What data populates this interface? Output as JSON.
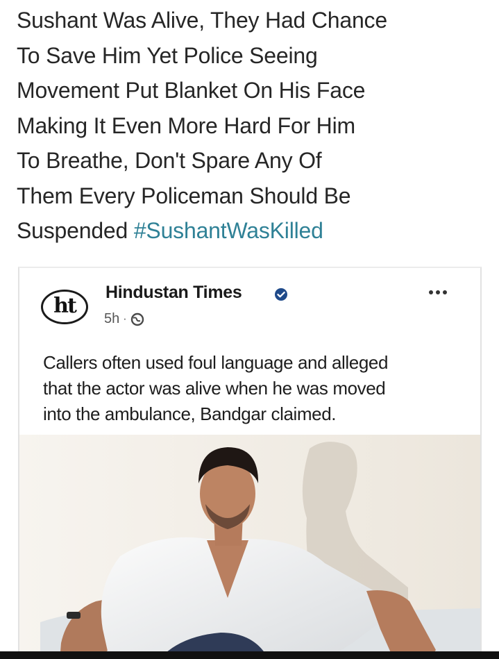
{
  "caption": {
    "lines": [
      "Sushant Was Alive, They Had Chance",
      "To Save Him Yet Police Seeing",
      "Movement Put Blanket On His Face",
      "Making It Even More Hard For Him",
      "To Breathe, Don't Spare Any Of",
      "Them Every Policeman Should Be"
    ],
    "last_line_prefix": "Suspended ",
    "hashtag": "#SushantWasKilled",
    "hashtag_color": "#2f8196"
  },
  "post": {
    "logo_text": "ht",
    "publisher": "Hindustan Times",
    "verified_icon": "verified-badge-icon",
    "verified_color": "#1f4a8a",
    "time": "5h",
    "separator": "·",
    "audience_icon": "globe-icon",
    "more_icon": "more-options-icon",
    "text_lines": [
      "Callers often used foul language and alleged",
      "that the actor was alive when he was moved",
      "into the ambulance, Bandgar claimed."
    ],
    "photo_icon": "post-photo"
  }
}
